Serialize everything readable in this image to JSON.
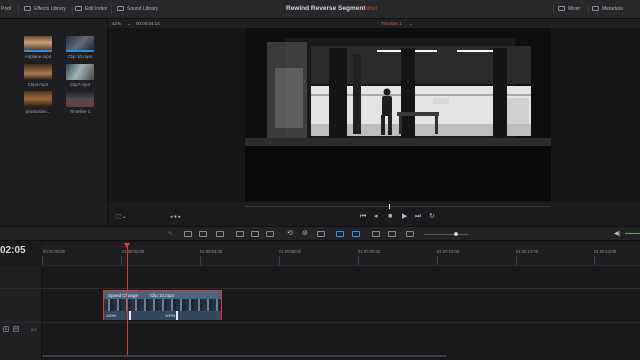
{
  "toolbar": {
    "pool_label": "Pool",
    "effects_library": "Effects Library",
    "edit_index": "Edit Index",
    "sound_library": "Sound Library",
    "mixer": "Mixer",
    "metadata": "Metadata"
  },
  "project": {
    "title": "Rewind Reverse Segment",
    "status": "Edited"
  },
  "viewer": {
    "zoom": "42%",
    "source_timecode": "00:00:04:14",
    "timeline_name": "Timeline 1",
    "dropdown_indicator": "⌄"
  },
  "media_pool": {
    "items": [
      {
        "label": "Airplane.mp4",
        "icon": "clip-thumbnail"
      },
      {
        "label": "Clip 10.mp4",
        "icon": "clip-thumbnail"
      },
      {
        "label": "Clip4.mp4",
        "icon": "clip-thumbnail"
      },
      {
        "label": "Clip7.mp4",
        "icon": "clip-thumbnail"
      },
      {
        "label": "production...",
        "icon": "clip-thumbnail"
      },
      {
        "label": "Timeline 1",
        "icon": "timeline-thumbnail"
      }
    ]
  },
  "timeline": {
    "timecode": "02:05",
    "ruler_labels": [
      "00:00:00:00",
      "01:00:02:00",
      "01:00:04:00",
      "01:00:06:00",
      "01:00:08:00",
      "01:00:10:00",
      "01:00:12:00",
      "01:00:14:00"
    ],
    "track_number": "2.0",
    "track_s": "S",
    "track_m": "M",
    "clip": {
      "speed_label": "Speed Change",
      "name": "Clip 10.mp4",
      "speed_left": "100%",
      "speed_right": "100%"
    }
  },
  "colors": {
    "accent_red": "#d63a2d",
    "clip_blue": "#3d566e",
    "active_blue": "#2f8ff0",
    "audio_green": "#3bbd5b"
  }
}
